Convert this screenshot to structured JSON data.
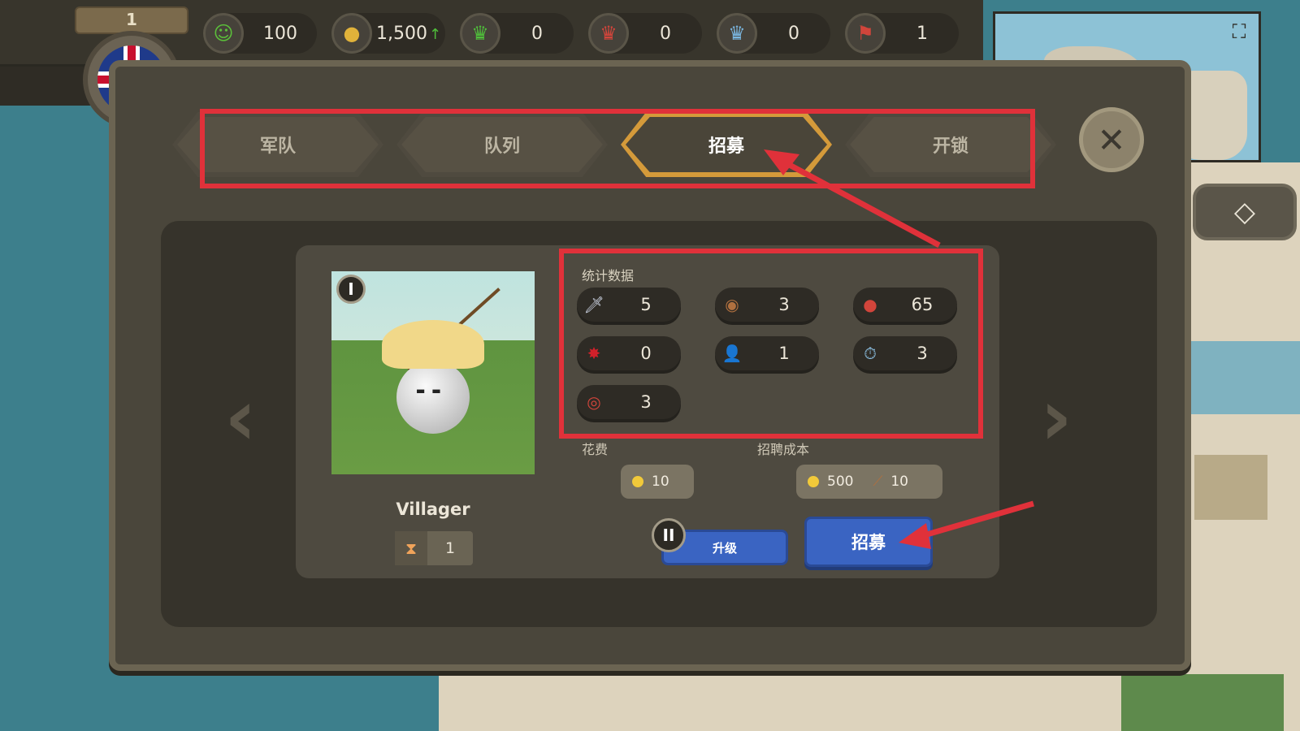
{
  "topbar": {
    "level": "1",
    "resources": [
      {
        "icon": "happiness-icon",
        "glyph": "☺",
        "color": "#5bbf3a",
        "value": "100"
      },
      {
        "icon": "gold-coins-icon",
        "glyph": "●",
        "color": "#e0b23a",
        "value": "1,500",
        "trend": "↑"
      },
      {
        "icon": "green-crown-icon",
        "glyph": "♛",
        "color": "#4fbf3a",
        "value": "0"
      },
      {
        "icon": "red-crown-icon",
        "glyph": "♛",
        "color": "#d2453b",
        "value": "0"
      },
      {
        "icon": "blue-crown-icon",
        "glyph": "♛",
        "color": "#7ab6e0",
        "value": "0"
      },
      {
        "icon": "flag-card-icon",
        "glyph": "⚑",
        "color": "#d2453b",
        "value": "1"
      }
    ]
  },
  "tabs": [
    {
      "label": "军队",
      "active": false
    },
    {
      "label": "队列",
      "active": false
    },
    {
      "label": "招募",
      "active": true
    },
    {
      "label": "开锁",
      "active": false
    }
  ],
  "unit": {
    "name": "Villager",
    "tier": "I",
    "count": "1",
    "stats_title": "统计数据",
    "stats": [
      {
        "icon": "sword-icon",
        "glyph": "🗡",
        "color": "#cfd6e6",
        "value": "5"
      },
      {
        "icon": "shield-icon",
        "glyph": "◉",
        "color": "#b0703f",
        "value": "3"
      },
      {
        "icon": "health-potion-icon",
        "glyph": "●",
        "color": "#d2453b",
        "value": "65"
      },
      {
        "icon": "critical-hit-icon",
        "glyph": "✸",
        "color": "#d2202a",
        "value": "0"
      },
      {
        "icon": "population-icon",
        "glyph": "👤",
        "color": "#d9d2c0",
        "value": "1"
      },
      {
        "icon": "stopwatch-icon",
        "glyph": "⏱",
        "color": "#8ec3e6",
        "value": "3"
      },
      {
        "icon": "target-speed-icon",
        "glyph": "◎",
        "color": "#d2453b",
        "value": "3"
      }
    ],
    "upkeep_label": "花费",
    "upkeep_value": "10",
    "recruit_cost_label": "招聘成本",
    "recruit_cost_gold": "500",
    "recruit_cost_material": "10",
    "upgrade_tier": "II",
    "upgrade_label": "升级",
    "recruit_label": "招募"
  }
}
